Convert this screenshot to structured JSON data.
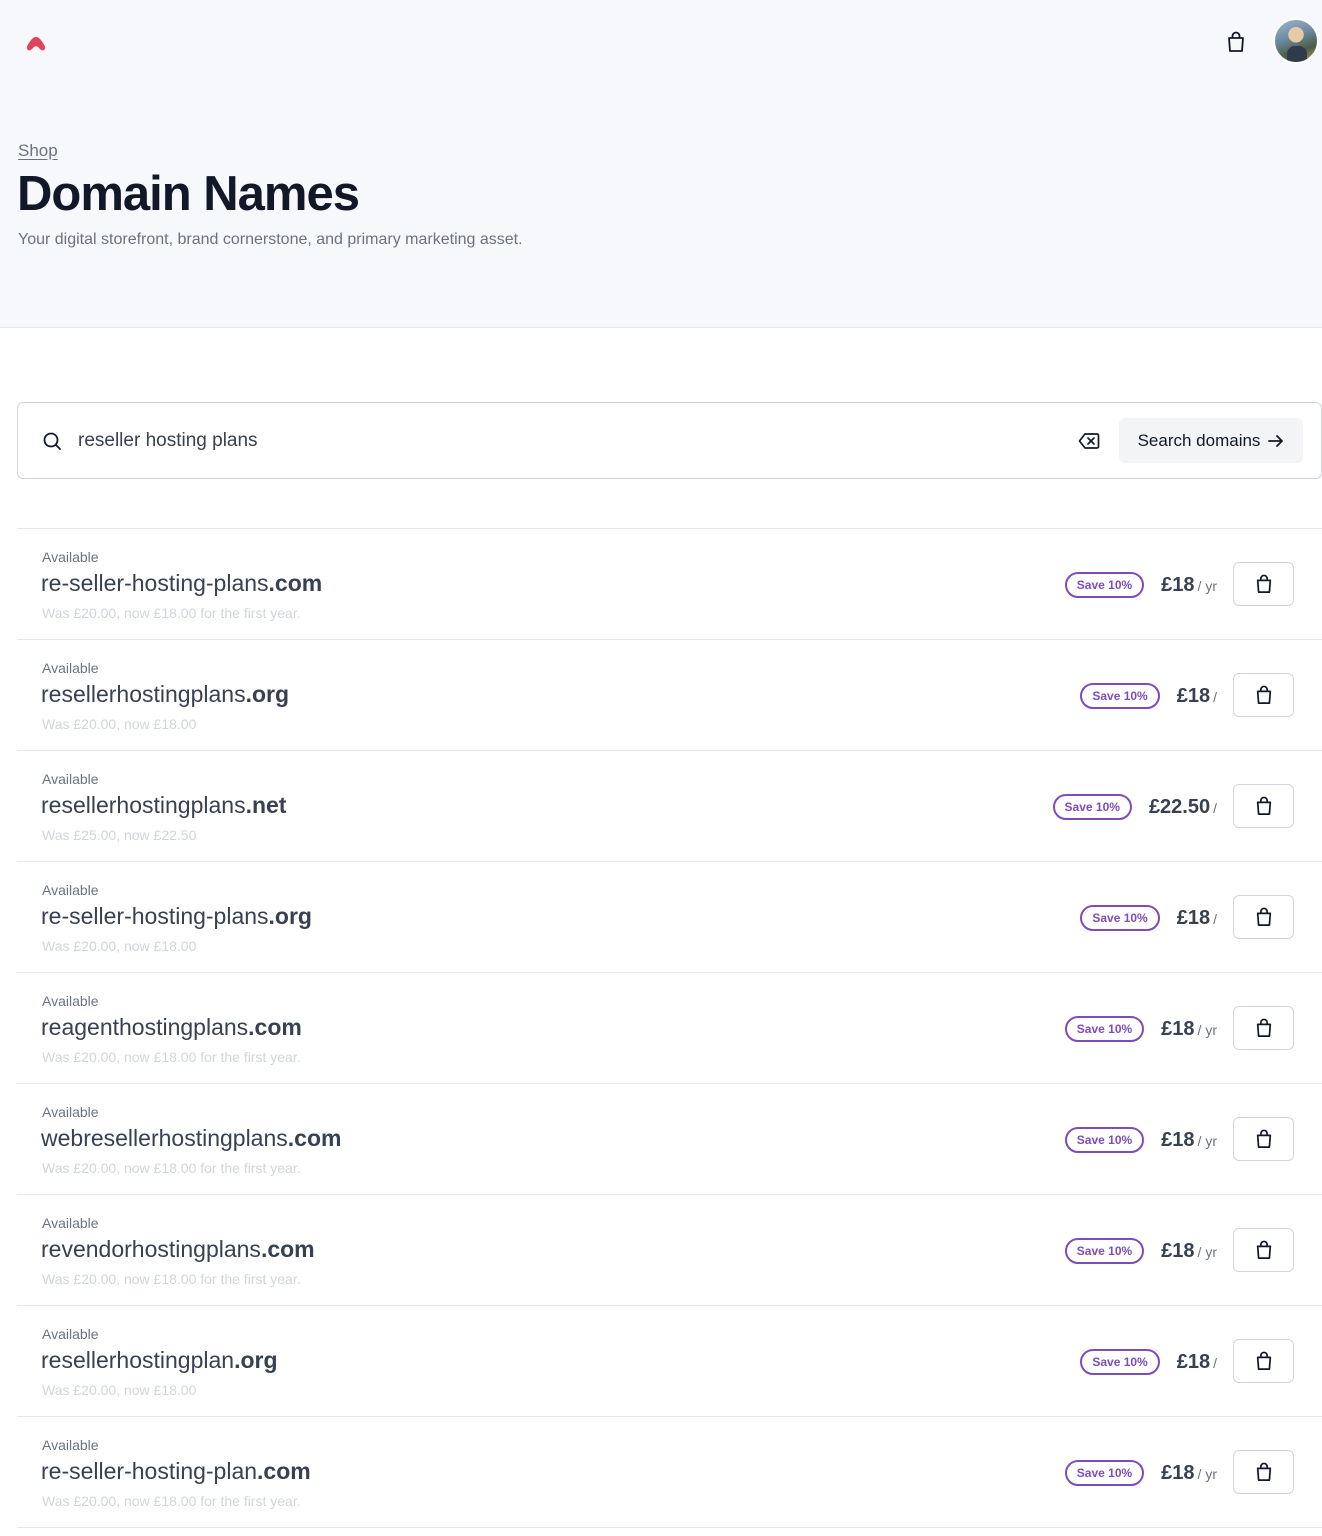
{
  "header": {
    "logo_icon": "brand-logo-icon",
    "cart_icon": "shopping-bag-icon",
    "avatar_icon": "user-avatar"
  },
  "hero": {
    "breadcrumb": "Shop",
    "title": "Domain Names",
    "subtitle": "Your digital storefront, brand cornerstone, and primary marketing asset."
  },
  "search": {
    "value": "reseller hosting plans",
    "button_label": "Search domains",
    "search_icon": "search-icon",
    "clear_icon": "clear-icon",
    "arrow_icon": "arrow-right-icon"
  },
  "colors": {
    "brand": "#e0435b",
    "badge": "#7c4dbc",
    "hero_bg": "#f7f8fb"
  },
  "results": [
    {
      "status": "Available",
      "name": "re-seller-hosting-plans",
      "tld": ".com",
      "note": "Was £20.00, now £18.00 for the first year.",
      "badge": "Save 10%",
      "price": "£18",
      "per": "/ yr"
    },
    {
      "status": "Available",
      "name": "resellerhostingplans",
      "tld": ".org",
      "note": "Was £20.00, now £18.00",
      "badge": "Save 10%",
      "price": "£18",
      "per": "/"
    },
    {
      "status": "Available",
      "name": "resellerhostingplans",
      "tld": ".net",
      "note": "Was £25.00, now £22.50",
      "badge": "Save 10%",
      "price": "£22.50",
      "per": "/"
    },
    {
      "status": "Available",
      "name": "re-seller-hosting-plans",
      "tld": ".org",
      "note": "Was £20.00, now £18.00",
      "badge": "Save 10%",
      "price": "£18",
      "per": "/"
    },
    {
      "status": "Available",
      "name": "reagenthostingplans",
      "tld": ".com",
      "note": "Was £20.00, now £18.00 for the first year.",
      "badge": "Save 10%",
      "price": "£18",
      "per": "/ yr"
    },
    {
      "status": "Available",
      "name": "webresellerhostingplans",
      "tld": ".com",
      "note": "Was £20.00, now £18.00 for the first year.",
      "badge": "Save 10%",
      "price": "£18",
      "per": "/ yr"
    },
    {
      "status": "Available",
      "name": "revendorhostingplans",
      "tld": ".com",
      "note": "Was £20.00, now £18.00 for the first year.",
      "badge": "Save 10%",
      "price": "£18",
      "per": "/ yr"
    },
    {
      "status": "Available",
      "name": "resellerhostingplan",
      "tld": ".org",
      "note": "Was £20.00, now £18.00",
      "badge": "Save 10%",
      "price": "£18",
      "per": "/"
    },
    {
      "status": "Available",
      "name": "re-seller-hosting-plan",
      "tld": ".com",
      "note": "Was £20.00, now £18.00 for the first year.",
      "badge": "Save 10%",
      "price": "£18",
      "per": "/ yr"
    }
  ]
}
